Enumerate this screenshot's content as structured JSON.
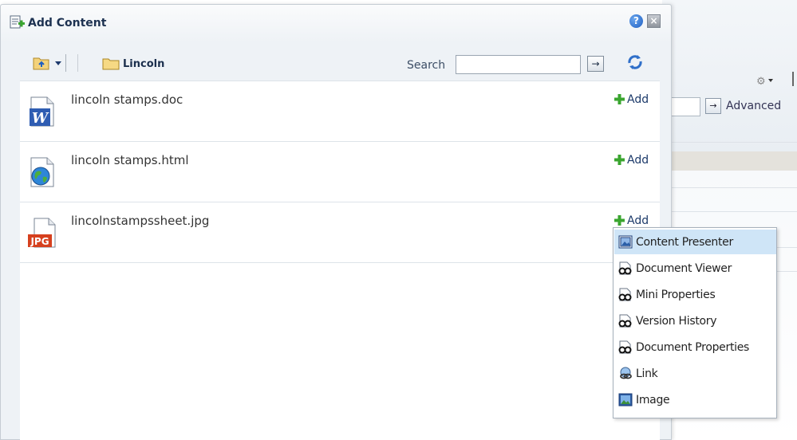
{
  "dialog": {
    "title": "Add Content",
    "help_label": "?",
    "close_label": "×"
  },
  "toolbar": {
    "breadcrumb": "Lincoln",
    "search_label": "Search",
    "search_value": "",
    "go_label": "→"
  },
  "files": [
    {
      "name": "lincoln stamps.doc",
      "type_icon": "word-doc-icon",
      "add_label": "Add"
    },
    {
      "name": "lincoln stamps.html",
      "type_icon": "html-globe-icon",
      "add_label": "Add"
    },
    {
      "name": "lincolnstampssheet.jpg",
      "type_icon": "jpg-image-icon",
      "add_label": "Add"
    }
  ],
  "menu": {
    "items": [
      {
        "label": "Content Presenter",
        "icon": "content-presenter-icon",
        "highlighted": true
      },
      {
        "label": "Document Viewer",
        "icon": "binoculars-icon"
      },
      {
        "label": "Mini Properties",
        "icon": "binoculars-icon"
      },
      {
        "label": "Version History",
        "icon": "binoculars-icon"
      },
      {
        "label": "Document Properties",
        "icon": "binoculars-icon"
      },
      {
        "label": "Link",
        "icon": "link-chain-icon"
      },
      {
        "label": "Image",
        "icon": "image-icon"
      }
    ]
  },
  "background": {
    "advanced_label": "Advanced",
    "go_label": "→"
  },
  "colors": {
    "dialog_bg": "#eef2f6",
    "title_text": "#1d3251",
    "menu_highlight": "#cfe5f7",
    "add_plus": "#3aa52f"
  }
}
